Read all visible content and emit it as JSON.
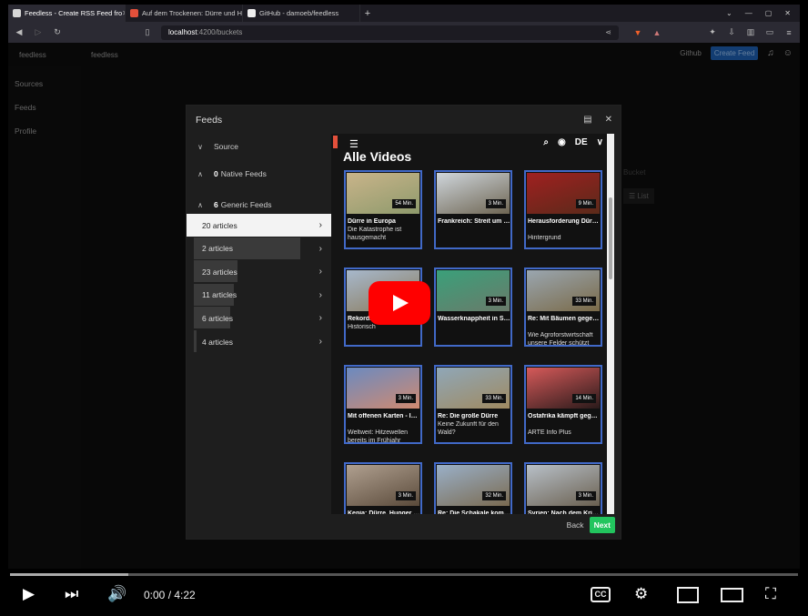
{
  "browser": {
    "tabs": [
      {
        "label": "Feedless - Create RSS Feed fro",
        "fav": "#d7d7d7",
        "active": true
      },
      {
        "label": "Auf dem Trockenen: Dürre und H",
        "fav": "#e3503b",
        "active": false
      },
      {
        "label": "GitHub - damoeb/feedless",
        "fav": "#eeeeee",
        "active": false
      }
    ],
    "url_host": "localhost",
    "url_rest": ":4200/buckets",
    "window_controls": [
      "⌄",
      "—",
      "▢",
      "✕"
    ]
  },
  "app": {
    "brand": "feedless",
    "brand_center": "feedless",
    "header": {
      "github": "Github",
      "create_feed": "Create Feed",
      "bell_icon": "bell-icon",
      "user_icon": "user-icon"
    },
    "sidenav": [
      "Sources",
      "Feeds",
      "Profile"
    ],
    "background": {
      "bucket": "Bucket",
      "list": "List"
    }
  },
  "modal": {
    "title": "Feeds",
    "tree": {
      "source": "Source",
      "native_count": "0",
      "native_label": "Native Feeds",
      "generic_count": "6",
      "generic_label": "Generic Feeds"
    },
    "articles": [
      {
        "label": "20 articles",
        "level": 1.0,
        "selected": true
      },
      {
        "label": "2 articles",
        "level": 0.88
      },
      {
        "label": "23 articles",
        "level": 0.36
      },
      {
        "label": "11 articles",
        "level": 0.33
      },
      {
        "label": "6 articles",
        "level": 0.3
      },
      {
        "label": "4 articles",
        "level": 0.02
      }
    ],
    "back": "Back",
    "next": "Next"
  },
  "preview": {
    "heading": "Alle Videos",
    "lang": "DE",
    "cards": [
      {
        "title": "Dürre in Europa",
        "sub": "Die Katastrophe ist hausgemacht",
        "dur": "54 Min.",
        "c1": "#c9b48a",
        "c2": "#8e9a6c"
      },
      {
        "title": "Frankreich: Streit um Mega-Wasserbecke…",
        "sub": "",
        "dur": "3 Min.",
        "c1": "#cfd6dc",
        "c2": "#6e6552"
      },
      {
        "title": "Herausforderung Dürre: Wie passen w…",
        "sub": "Hintergrund",
        "dur": "9 Min.",
        "c1": "#a02020",
        "c2": "#5a2a1a"
      },
      {
        "title": "Rekordhitze:",
        "sub": "Historisch",
        "dur": "",
        "c1": "#a7b8cc",
        "c2": "#8a7a5a"
      },
      {
        "title": "Wasserknappheit in Spanien: Entsalzun…",
        "sub": "",
        "dur": "3 Min.",
        "c1": "#3aa07a",
        "c2": "#6a7a6a"
      },
      {
        "title": "Re: Mit Bäumen gegen die Dürre",
        "sub": "Wie Agroforstwirtschaft unsere Felder schützt",
        "dur": "33 Min.",
        "c1": "#9aa6b0",
        "c2": "#7a6a48"
      },
      {
        "title": "Mit offenen Karten - Im Fokus",
        "sub": "Weltweit: Hitzewellen bereits im Frühjahr",
        "dur": "3 Min.",
        "c1": "#6b8ac0",
        "c2": "#d08a70"
      },
      {
        "title": "Re: Die große Dürre",
        "sub": "Keine Zukunft für den Wald?",
        "dur": "33 Min.",
        "c1": "#8fa7b8",
        "c2": "#a08a60"
      },
      {
        "title": "Ostafrika kämpft gegen schwerste…",
        "sub": "ARTE Info Plus",
        "dur": "14 Min.",
        "c1": "#d65a5a",
        "c2": "#2a1a1a"
      },
      {
        "title": "Kenia: Dürre, Hunger und steigende…",
        "sub": "",
        "dur": "3 Min.",
        "c1": "#b0a090",
        "c2": "#5a4a3a"
      },
      {
        "title": "Re: Die Schakale kommen",
        "sub": "",
        "dur": "32 Min.",
        "c1": "#9ab0c8",
        "c2": "#7a6a50"
      },
      {
        "title": "Syrien: Nach dem Krieg die Dürre",
        "sub": "",
        "dur": "3 Min.",
        "c1": "#b8c0c8",
        "c2": "#6a6050"
      }
    ]
  },
  "player": {
    "time": "0:00 / 4:22",
    "progress": 0.0,
    "buffered": 0.15,
    "cc_label": "CC"
  }
}
